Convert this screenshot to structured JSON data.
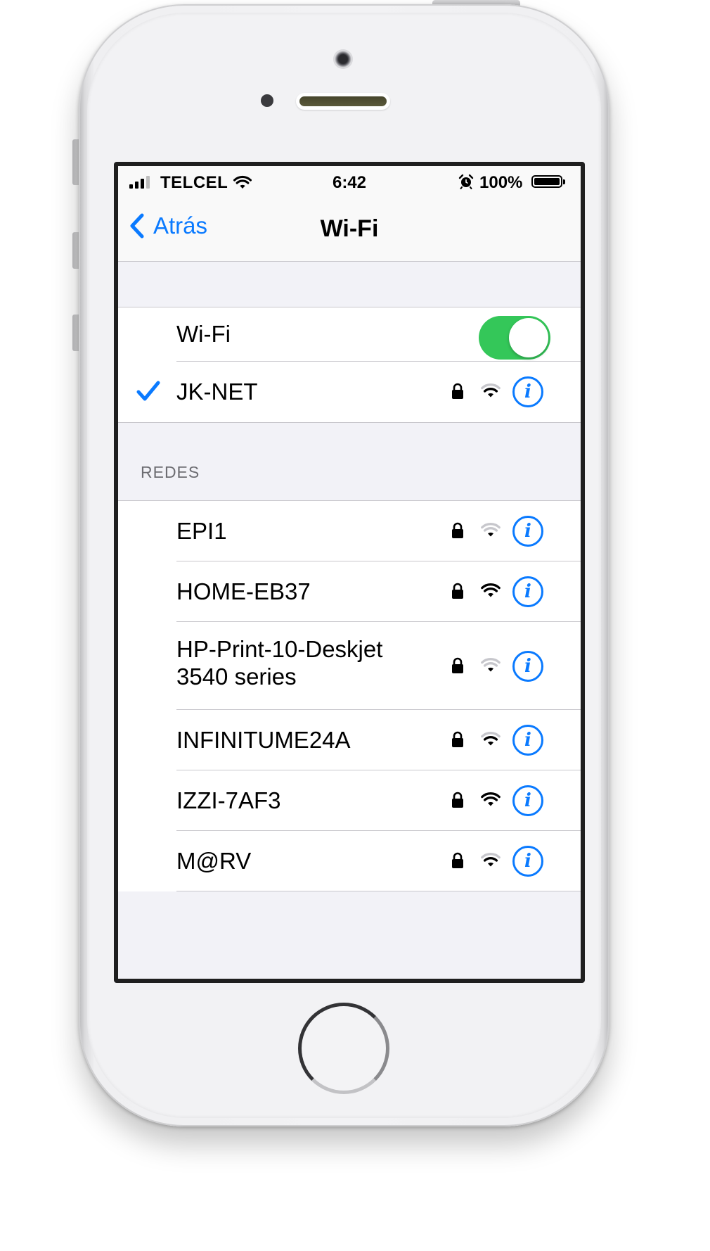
{
  "status_bar": {
    "carrier": "TELCEL",
    "time": "6:42",
    "battery_percent": "100%",
    "battery_level": 1.0,
    "signal_bars": 3,
    "icons": [
      "signal-icon",
      "wifi-icon",
      "alarm-icon",
      "battery-icon"
    ]
  },
  "nav": {
    "back_label": "Atrás",
    "title": "Wi-Fi"
  },
  "wifi_toggle": {
    "label": "Wi-Fi",
    "on": true
  },
  "connected": {
    "name": "JK-NET",
    "secured": true,
    "signal": "medium"
  },
  "networks_header": "REDES",
  "networks": [
    {
      "name": "EPI1",
      "secured": true,
      "signal": "weak"
    },
    {
      "name": "HOME-EB37",
      "secured": true,
      "signal": "full"
    },
    {
      "name": "HP-Print-10-Deskjet",
      "name_line2": "3540 series",
      "secured": true,
      "signal": "weak"
    },
    {
      "name": "INFINITUME24A",
      "secured": true,
      "signal": "medium"
    },
    {
      "name": "IZZI-7AF3",
      "secured": true,
      "signal": "full"
    },
    {
      "name": "M@RV",
      "secured": true,
      "signal": "medium"
    }
  ],
  "colors": {
    "accent": "#0a7aff",
    "toggle_on": "#34c759",
    "grouped_background": "#f2f2f7",
    "separator": "#c8c7cc"
  },
  "info_glyph": "i"
}
